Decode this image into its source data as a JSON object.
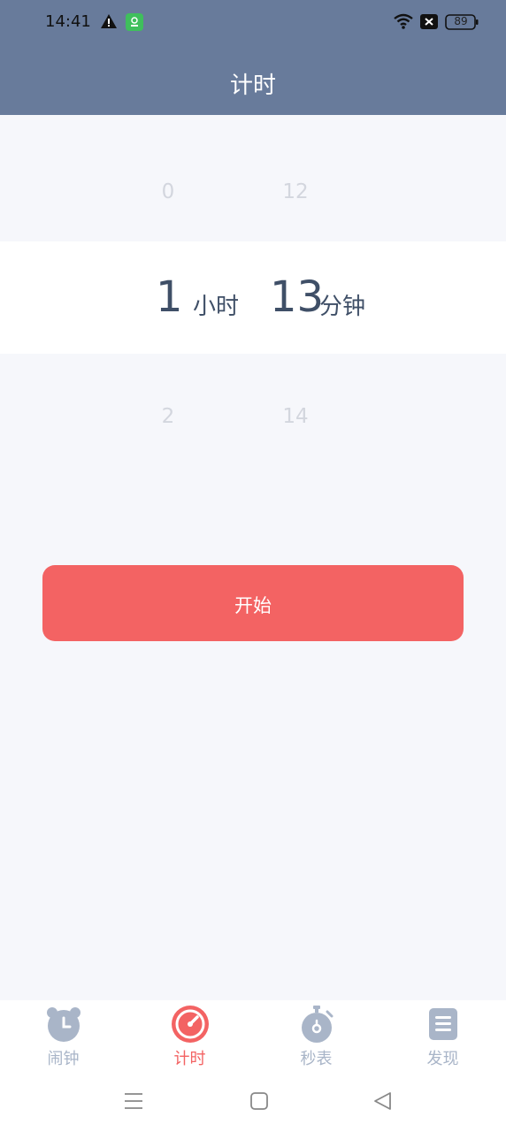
{
  "status_bar": {
    "time": "14:41",
    "battery": "89"
  },
  "header": {
    "title": "计时"
  },
  "picker": {
    "hours": {
      "prev": "0",
      "selected": "1",
      "next": "2",
      "unit": "小时"
    },
    "minutes": {
      "prev": "12",
      "selected": "13",
      "next": "14",
      "unit": "分钟"
    }
  },
  "start_button": {
    "label": "开始"
  },
  "bottom_nav": {
    "items": [
      {
        "label": "闹钟",
        "icon": "alarm-clock-icon",
        "active": false
      },
      {
        "label": "计时",
        "icon": "timer-icon",
        "active": true
      },
      {
        "label": "秒表",
        "icon": "stopwatch-icon",
        "active": false
      },
      {
        "label": "发现",
        "icon": "discover-icon",
        "active": false
      }
    ]
  },
  "colors": {
    "header_bg": "#687b9b",
    "accent": "#f36363",
    "inactive": "#a9b5c8",
    "text_primary": "#3f4f67",
    "background": "#f6f7fb"
  }
}
